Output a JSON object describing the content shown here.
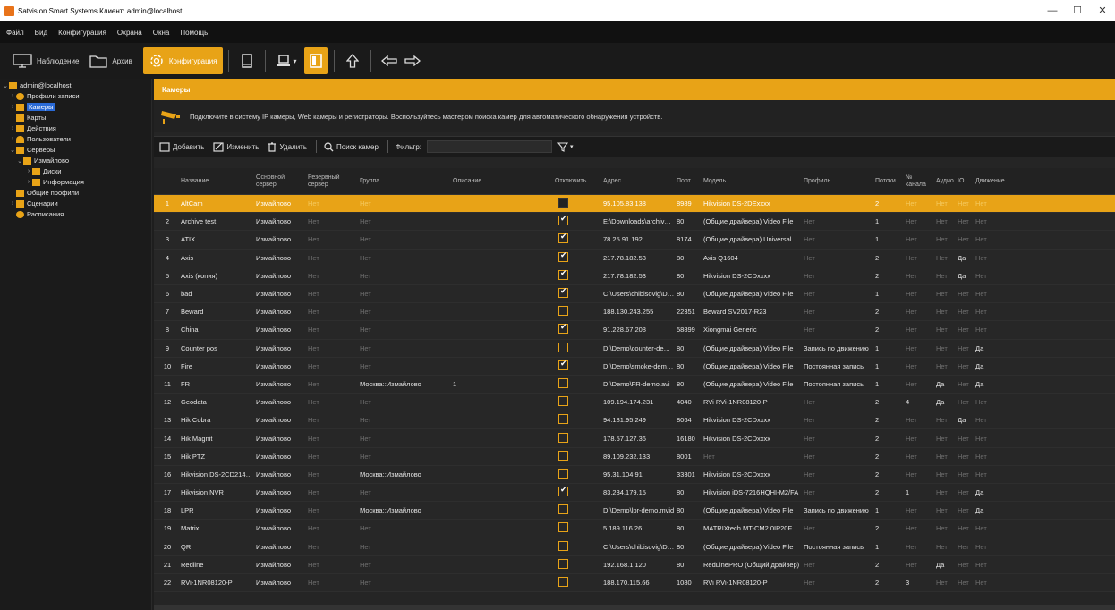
{
  "window": {
    "title": "Satvision Smart Systems Клиент: admin@localhost",
    "min": "—",
    "max": "☐",
    "close": "✕"
  },
  "menu": [
    "Файл",
    "Вид",
    "Конфигурация",
    "Охрана",
    "Окна",
    "Помощь"
  ],
  "toolbar": {
    "observe": "Наблюдение",
    "archive": "Архив",
    "config": "Конфигурация"
  },
  "sidebar": {
    "root": "admin@localhost",
    "items": {
      "profiles": "Профили записи",
      "cameras": "Камеры",
      "maps": "Карты",
      "actions": "Действия",
      "users": "Пользователи",
      "servers": "Серверы",
      "izmailovo": "Измайлово",
      "disks": "Диски",
      "info": "Информация",
      "common_profiles": "Общие профили",
      "scenarios": "Сценарии",
      "schedules": "Расписания"
    }
  },
  "main": {
    "header": "Камеры",
    "info": "Подключите в систему IP камеры, Web камеры и регистраторы. Воспользуйтесь мастером поиска камер для автоматического обнаружения устройств.",
    "actions": {
      "add": "Добавить",
      "edit": "Изменить",
      "delete": "Удалить",
      "search": "Поиск камер",
      "filter": "Фильтр:"
    }
  },
  "table": {
    "columns": [
      "",
      "Название",
      "Основной\nсервер",
      "Резервный\nсервер",
      "Группа",
      "Описание",
      "Отключить",
      "Адрес",
      "Порт",
      "Модель",
      "Профиль",
      "Потоки",
      "№ канала",
      "Аудио",
      "IO",
      "Движение"
    ],
    "rows": [
      {
        "n": "1",
        "name": "AltCam",
        "server": "Измайлово",
        "backup": "Нет",
        "group": "Нет",
        "desc": "",
        "off": "dark",
        "addr": "95.105.83.138",
        "port": "8989",
        "model": "Hikvision DS-2DExxxx",
        "profile": "",
        "streams": "2",
        "ch": "Нет",
        "audio": "Нет",
        "io": "Нет",
        "motion": "Нет"
      },
      {
        "n": "2",
        "name": "Archive test",
        "server": "Измайлово",
        "backup": "Нет",
        "group": "Нет",
        "desc": "",
        "off": "checked",
        "addr": "E:\\Downloads\\archive_3...",
        "port": "80",
        "model": "(Общие драйвера) Video File",
        "profile": "Нет",
        "streams": "1",
        "ch": "Нет",
        "audio": "Нет",
        "io": "Нет",
        "motion": "Нет"
      },
      {
        "n": "3",
        "name": "ATIX",
        "server": "Измайлово",
        "backup": "Нет",
        "group": "Нет",
        "desc": "",
        "off": "checked",
        "addr": "78.25.91.192",
        "port": "8174",
        "model": "(Общие драйвера) Universal ON...",
        "profile": "Нет",
        "streams": "1",
        "ch": "Нет",
        "audio": "Нет",
        "io": "Нет",
        "motion": "Нет"
      },
      {
        "n": "4",
        "name": "Axis",
        "server": "Измайлово",
        "backup": "Нет",
        "group": "Нет",
        "desc": "",
        "off": "checked",
        "addr": "217.78.182.53",
        "port": "80",
        "model": "Axis Q1604",
        "profile": "Нет",
        "streams": "2",
        "ch": "Нет",
        "audio": "Нет",
        "io": "Да",
        "motion": "Нет"
      },
      {
        "n": "5",
        "name": "Axis (копия)",
        "server": "Измайлово",
        "backup": "Нет",
        "group": "Нет",
        "desc": "",
        "off": "checked",
        "addr": "217.78.182.53",
        "port": "80",
        "model": "Hikvision DS-2CDxxxx",
        "profile": "Нет",
        "streams": "2",
        "ch": "Нет",
        "audio": "Нет",
        "io": "Да",
        "motion": "Нет"
      },
      {
        "n": "6",
        "name": "bad",
        "server": "Измайлово",
        "backup": "Нет",
        "group": "Нет",
        "desc": "",
        "off": "checked",
        "addr": "C:\\Users\\chibisovig\\Des...",
        "port": "80",
        "model": "(Общие драйвера) Video File",
        "profile": "Нет",
        "streams": "1",
        "ch": "Нет",
        "audio": "Нет",
        "io": "Нет",
        "motion": "Нет"
      },
      {
        "n": "7",
        "name": "Beward",
        "server": "Измайлово",
        "backup": "Нет",
        "group": "Нет",
        "desc": "",
        "off": "",
        "addr": "188.130.243.255",
        "port": "22351",
        "model": "Beward SV2017-R23",
        "profile": "Нет",
        "streams": "2",
        "ch": "Нет",
        "audio": "Нет",
        "io": "Нет",
        "motion": "Нет"
      },
      {
        "n": "8",
        "name": "China",
        "server": "Измайлово",
        "backup": "Нет",
        "group": "Нет",
        "desc": "",
        "off": "checked",
        "addr": "91.228.67.208",
        "port": "58899",
        "model": "Xiongmai Generic",
        "profile": "Нет",
        "streams": "2",
        "ch": "Нет",
        "audio": "Нет",
        "io": "Нет",
        "motion": "Нет"
      },
      {
        "n": "9",
        "name": "Counter pos",
        "server": "Измайлово",
        "backup": "Нет",
        "group": "Нет",
        "desc": "",
        "off": "",
        "addr": "D:\\Demo\\counter-demo.r...",
        "port": "80",
        "model": "(Общие драйвера) Video File",
        "profile": "Запись по движению",
        "streams": "1",
        "ch": "Нет",
        "audio": "Нет",
        "io": "Нет",
        "motion": "Да"
      },
      {
        "n": "10",
        "name": "Fire",
        "server": "Измайлово",
        "backup": "Нет",
        "group": "Нет",
        "desc": "",
        "off": "checked",
        "addr": "D:\\Demo\\smoke-demo.m...",
        "port": "80",
        "model": "(Общие драйвера) Video File",
        "profile": "Постоянная запись",
        "streams": "1",
        "ch": "Нет",
        "audio": "Нет",
        "io": "Нет",
        "motion": "Да"
      },
      {
        "n": "11",
        "name": "FR",
        "server": "Измайлово",
        "backup": "Нет",
        "group": "Москва::Измайлово",
        "desc": "1",
        "off": "",
        "addr": "D:\\Demo\\FR-demo.avi",
        "port": "80",
        "model": "(Общие драйвера) Video File",
        "profile": "Постоянная запись",
        "streams": "1",
        "ch": "Нет",
        "audio": "Да",
        "io": "Нет",
        "motion": "Да"
      },
      {
        "n": "12",
        "name": "Geodata",
        "server": "Измайлово",
        "backup": "Нет",
        "group": "Нет",
        "desc": "",
        "off": "",
        "addr": "109.194.174.231",
        "port": "4040",
        "model": "RVi RVi-1NR08120-P",
        "profile": "Нет",
        "streams": "2",
        "ch": "4",
        "audio": "Да",
        "io": "Нет",
        "motion": "Нет"
      },
      {
        "n": "13",
        "name": "Hik Cobra",
        "server": "Измайлово",
        "backup": "Нет",
        "group": "Нет",
        "desc": "",
        "off": "",
        "addr": "94.181.95.249",
        "port": "8064",
        "model": "Hikvision DS-2CDxxxx",
        "profile": "Нет",
        "streams": "2",
        "ch": "Нет",
        "audio": "Нет",
        "io": "Да",
        "motion": "Нет"
      },
      {
        "n": "14",
        "name": "Hik Magnit",
        "server": "Измайлово",
        "backup": "Нет",
        "group": "Нет",
        "desc": "",
        "off": "",
        "addr": "178.57.127.36",
        "port": "16180",
        "model": "Hikvision DS-2CDxxxx",
        "profile": "Нет",
        "streams": "2",
        "ch": "Нет",
        "audio": "Нет",
        "io": "Нет",
        "motion": "Нет"
      },
      {
        "n": "15",
        "name": "Hik PTZ",
        "server": "Измайлово",
        "backup": "Нет",
        "group": "Нет",
        "desc": "",
        "off": "",
        "addr": "89.109.232.133",
        "port": "8001",
        "model": "Нет",
        "profile": "Нет",
        "streams": "2",
        "ch": "Нет",
        "audio": "Нет",
        "io": "Нет",
        "motion": "Нет"
      },
      {
        "n": "16",
        "name": "Hikvision DS-2CD2142FW...",
        "server": "Измайлово",
        "backup": "Нет",
        "group": "Москва::Измайлово",
        "desc": "",
        "off": "",
        "addr": "95.31.104.91",
        "port": "33301",
        "model": "Hikvision DS-2CDxxxx",
        "profile": "Нет",
        "streams": "2",
        "ch": "Нет",
        "audio": "Нет",
        "io": "Нет",
        "motion": "Нет"
      },
      {
        "n": "17",
        "name": "Hikvision NVR",
        "server": "Измайлово",
        "backup": "Нет",
        "group": "Нет",
        "desc": "",
        "off": "checked",
        "addr": "83.234.179.15",
        "port": "80",
        "model": "Hikvision iDS-7216HQHI-M2/FA",
        "profile": "Нет",
        "streams": "2",
        "ch": "1",
        "audio": "Нет",
        "io": "Нет",
        "motion": "Да"
      },
      {
        "n": "18",
        "name": "LPR",
        "server": "Измайлово",
        "backup": "Нет",
        "group": "Москва::Измайлово",
        "desc": "",
        "off": "",
        "addr": "D:\\Demo\\lpr-demo.mvid",
        "port": "80",
        "model": "(Общие драйвера) Video File",
        "profile": "Запись по движению",
        "streams": "1",
        "ch": "Нет",
        "audio": "Нет",
        "io": "Нет",
        "motion": "Да"
      },
      {
        "n": "19",
        "name": "Matrix",
        "server": "Измайлово",
        "backup": "Нет",
        "group": "Нет",
        "desc": "",
        "off": "",
        "addr": "5.189.116.26",
        "port": "80",
        "model": "MATRIXtech MT-CM2.0IP20F",
        "profile": "Нет",
        "streams": "2",
        "ch": "Нет",
        "audio": "Нет",
        "io": "Нет",
        "motion": "Нет"
      },
      {
        "n": "20",
        "name": "QR",
        "server": "Измайлово",
        "backup": "Нет",
        "group": "Нет",
        "desc": "",
        "off": "",
        "addr": "C:\\Users\\chibisovig\\Des...",
        "port": "80",
        "model": "(Общие драйвера) Video File",
        "profile": "Постоянная запись",
        "streams": "1",
        "ch": "Нет",
        "audio": "Нет",
        "io": "Нет",
        "motion": "Нет"
      },
      {
        "n": "21",
        "name": "Redline",
        "server": "Измайлово",
        "backup": "Нет",
        "group": "Нет",
        "desc": "",
        "off": "",
        "addr": "192.168.1.120",
        "port": "80",
        "model": "RedLinePRO (Общий драйвер)",
        "profile": "Нет",
        "streams": "2",
        "ch": "Нет",
        "audio": "Да",
        "io": "Нет",
        "motion": "Нет"
      },
      {
        "n": "22",
        "name": "RVi-1NR08120-P",
        "server": "Измайлово",
        "backup": "Нет",
        "group": "Нет",
        "desc": "",
        "off": "",
        "addr": "188.170.115.66",
        "port": "1080",
        "model": "RVi RVi-1NR08120-P",
        "profile": "Нет",
        "streams": "2",
        "ch": "3",
        "audio": "Нет",
        "io": "Нет",
        "motion": "Нет"
      }
    ]
  }
}
